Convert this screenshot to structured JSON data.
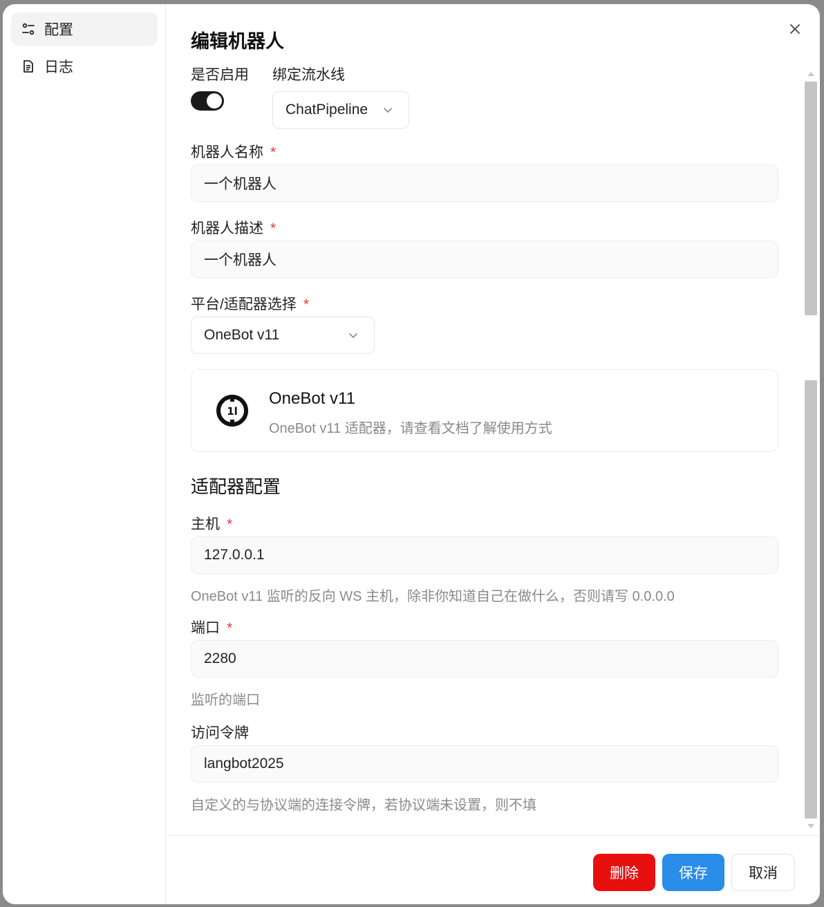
{
  "sidebar": {
    "items": [
      {
        "label": "配置",
        "icon": "settings-sliders-icon",
        "active": true
      },
      {
        "label": "日志",
        "icon": "document-icon",
        "active": false
      }
    ]
  },
  "dialog": {
    "title": "编辑机器人",
    "close_icon": "close-icon"
  },
  "form": {
    "enable_label": "是否启用",
    "enabled": true,
    "pipeline_label": "绑定流水线",
    "pipeline_value": "ChatPipeline",
    "name_label": "机器人名称",
    "name_value": "一个机器人",
    "desc_label": "机器人描述",
    "desc_value": "一个机器人",
    "platform_label": "平台/适配器选择",
    "platform_value": "OneBot v11",
    "required_mark": "*"
  },
  "adapter": {
    "logo_icon": "onebot-logo-icon",
    "name": "OneBot v11",
    "description": "OneBot v11 适配器，请查看文档了解使用方式"
  },
  "adapter_config": {
    "section_title": "适配器配置",
    "host_label": "主机",
    "host_value": "127.0.0.1",
    "host_help": "OneBot v11 监听的反向 WS 主机，除非你知道自己在做什么，否则请写 0.0.0.0",
    "port_label": "端口",
    "port_value": "2280",
    "port_help": "监听的端口",
    "token_label": "访问令牌",
    "token_value": "langbot2025",
    "token_help": "自定义的与协议端的连接令牌，若协议端未设置，则不填"
  },
  "footer": {
    "delete_label": "删除",
    "save_label": "保存",
    "cancel_label": "取消"
  },
  "colors": {
    "delete": "#e8100f",
    "save": "#2a8de8",
    "required": "#e53935"
  }
}
